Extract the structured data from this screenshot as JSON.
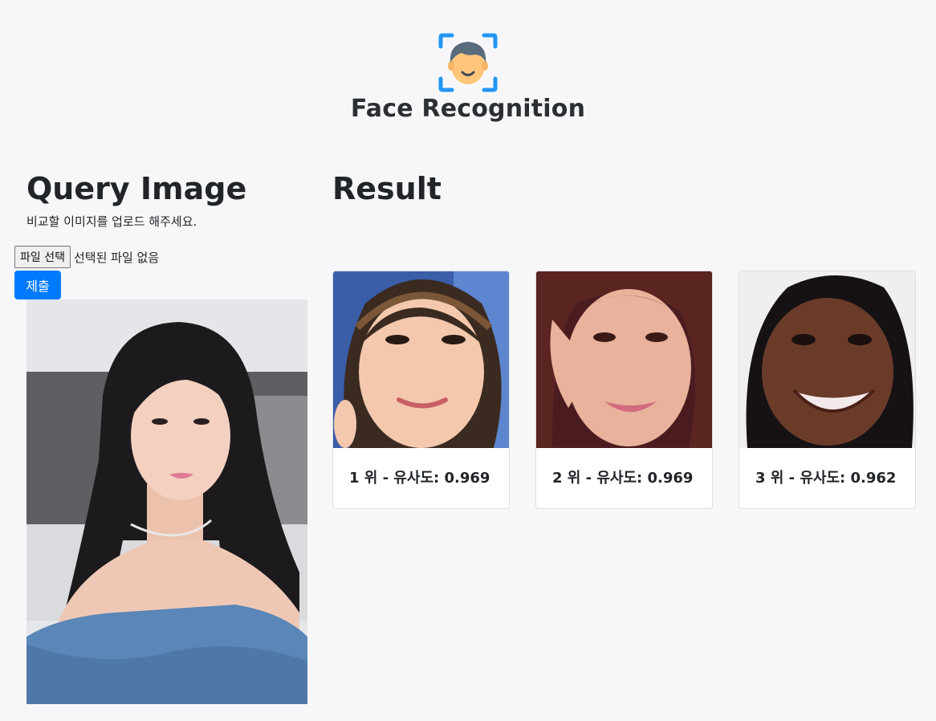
{
  "header": {
    "logo_icon": "face-scan-icon",
    "title": "Face Recognition"
  },
  "query": {
    "title": "Query Image",
    "help_text": "비교할 이미지를 업로드 해주세요.",
    "file_button_label": "파일 선택",
    "file_status": "선택된 파일 없음",
    "submit_label": "제출"
  },
  "result": {
    "title": "Result",
    "cards": [
      {
        "caption": "1 위 - 유사도: 0.969"
      },
      {
        "caption": "2 위 - 유사도: 0.969"
      },
      {
        "caption": "3 위 - 유사도: 0.962"
      }
    ]
  },
  "colors": {
    "background": "#f7f7f9",
    "primary": "#007bff",
    "logo_blue": "#2196f3",
    "logo_face": "#ffc67a",
    "logo_hair": "#5a6b7c"
  }
}
